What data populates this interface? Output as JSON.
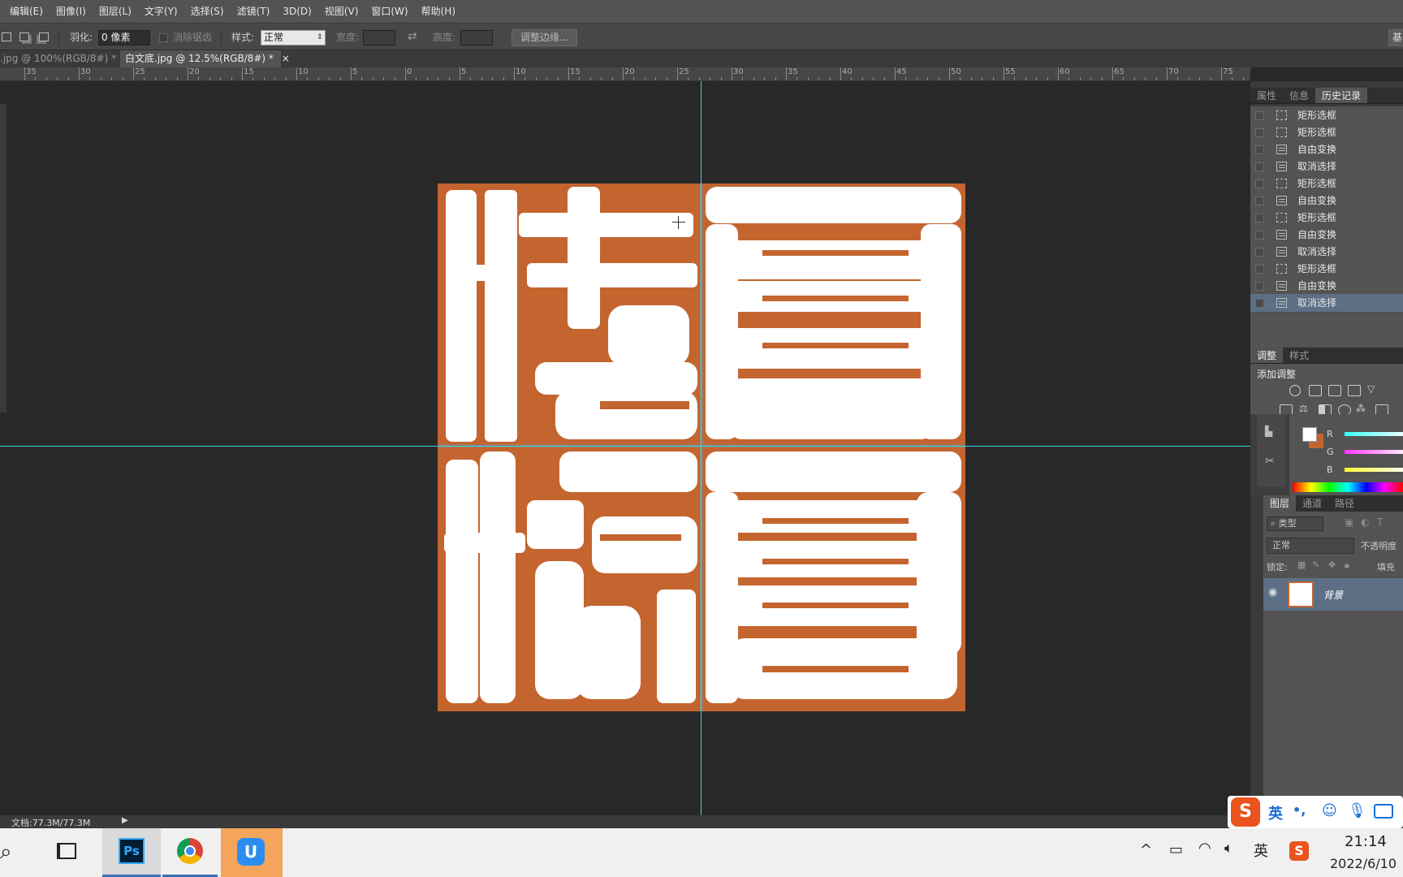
{
  "menubar": {
    "items": [
      "编辑(E)",
      "图像(I)",
      "图层(L)",
      "文字(Y)",
      "选择(S)",
      "滤镜(T)",
      "3D(D)",
      "视图(V)",
      "窗口(W)",
      "帮助(H)"
    ]
  },
  "options": {
    "feather_label": "羽化:",
    "feather_value": "0 像素",
    "antialias_label": "消除锯齿",
    "style_label": "样式:",
    "style_value": "正常",
    "width_label": "宽度:",
    "height_label": "高度:",
    "refine_button": "调整边缘...",
    "right_button": "基"
  },
  "tabs": [
    {
      "label": ".jpg @ 100%(RGB/8#) *",
      "close": "×",
      "active": false
    },
    {
      "label": "白文底.jpg @ 12.5%(RGB/8#) *",
      "close": "×",
      "active": true
    }
  ],
  "ruler": {
    "labels": [
      "35",
      "30",
      "25",
      "20",
      "15",
      "10",
      "5",
      "0",
      "5",
      "10",
      "15",
      "20",
      "25",
      "30",
      "35",
      "40",
      "45",
      "50",
      "55",
      "60",
      "65",
      "70",
      "75"
    ]
  },
  "document": {
    "seal_color": "#c4652f",
    "guide_color": "#3fd3e8"
  },
  "history_panel": {
    "tabs": [
      "属性",
      "信息",
      "历史记录"
    ],
    "active_tab": "历史记录",
    "items": [
      {
        "label": "矩形选框",
        "icon": "marquee-icon"
      },
      {
        "label": "矩形选框",
        "icon": "marquee-icon"
      },
      {
        "label": "自由变换",
        "icon": "document-icon"
      },
      {
        "label": "取消选择",
        "icon": "document-icon"
      },
      {
        "label": "矩形选框",
        "icon": "marquee-icon"
      },
      {
        "label": "自由变换",
        "icon": "document-icon"
      },
      {
        "label": "矩形选框",
        "icon": "marquee-icon"
      },
      {
        "label": "自由变换",
        "icon": "document-icon"
      },
      {
        "label": "取消选择",
        "icon": "document-icon"
      },
      {
        "label": "矩形选框",
        "icon": "marquee-icon"
      },
      {
        "label": "自由变换",
        "icon": "document-icon"
      },
      {
        "label": "取消选择",
        "icon": "document-icon"
      }
    ],
    "selected_index": 11
  },
  "adjust_panel": {
    "tabs": [
      "调整",
      "样式"
    ],
    "title": "添加调整"
  },
  "color_panel": {
    "channels": [
      "R",
      "G",
      "B"
    ],
    "foreground": "#ffffff",
    "background": "#c4652f"
  },
  "layers_panel": {
    "tabs": [
      "图层",
      "通道",
      "路径"
    ],
    "filter_label": "类型",
    "blend_mode": "正常",
    "opacity_label": "不透明度",
    "lock_label": "锁定:",
    "fill_label": "填充",
    "layer_name": "背景"
  },
  "status": {
    "doc_size": "文档:77.3M/77.3M"
  },
  "ime": {
    "lang": "英",
    "punct": "•,"
  },
  "taskbar": {
    "time": "21:14",
    "date": "2022/6/10",
    "lang": "英",
    "apps": [
      "Ps",
      "chrome",
      "uTools"
    ]
  }
}
